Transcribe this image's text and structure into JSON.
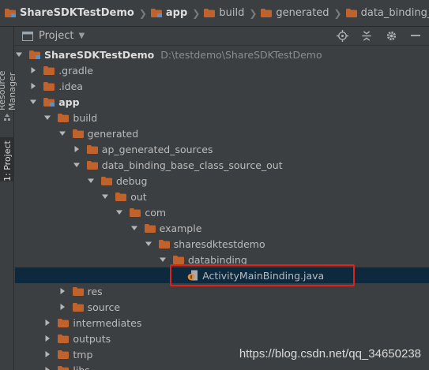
{
  "breadcrumb": [
    {
      "label": "ShareSDKTestDemo",
      "bold": true,
      "icon": "module-folder-icon"
    },
    {
      "label": "app",
      "bold": true,
      "icon": "module-folder-icon"
    },
    {
      "label": "build",
      "bold": false,
      "icon": "folder-icon"
    },
    {
      "label": "generated",
      "bold": false,
      "icon": "folder-icon"
    },
    {
      "label": "data_binding_base_class_s",
      "bold": false,
      "icon": "folder-icon"
    }
  ],
  "sidebar": {
    "tabs": [
      {
        "label": "Resource Manager",
        "active": false
      },
      {
        "label": "1: Project",
        "active": true
      }
    ]
  },
  "panel": {
    "title": "Project",
    "icons": [
      "locate-target-icon",
      "collapse-all-icon",
      "settings-gear-icon",
      "hide-minus-icon"
    ]
  },
  "tree": [
    {
      "depth": 0,
      "arrow": "down",
      "icon": "module",
      "label": "ShareSDKTestDemo",
      "bold": true,
      "path": "D:\\testdemo\\ShareSDKTestDemo"
    },
    {
      "depth": 1,
      "arrow": "right",
      "icon": "folder",
      "label": ".gradle"
    },
    {
      "depth": 1,
      "arrow": "right",
      "icon": "folder",
      "label": ".idea"
    },
    {
      "depth": 1,
      "arrow": "down",
      "icon": "module",
      "label": "app",
      "bold": true
    },
    {
      "depth": 2,
      "arrow": "down",
      "icon": "folder",
      "label": "build"
    },
    {
      "depth": 3,
      "arrow": "down",
      "icon": "folder",
      "label": "generated"
    },
    {
      "depth": 4,
      "arrow": "right",
      "icon": "folder",
      "label": "ap_generated_sources"
    },
    {
      "depth": 4,
      "arrow": "down",
      "icon": "folder",
      "label": "data_binding_base_class_source_out"
    },
    {
      "depth": 5,
      "arrow": "down",
      "icon": "folder",
      "label": "debug"
    },
    {
      "depth": 6,
      "arrow": "down",
      "icon": "folder",
      "label": "out"
    },
    {
      "depth": 7,
      "arrow": "down",
      "icon": "folder",
      "label": "com"
    },
    {
      "depth": 8,
      "arrow": "down",
      "icon": "folder",
      "label": "example"
    },
    {
      "depth": 9,
      "arrow": "down",
      "icon": "folder",
      "label": "sharesdktestdemo"
    },
    {
      "depth": 10,
      "arrow": "down",
      "icon": "folder",
      "label": "databinding"
    },
    {
      "depth": 11,
      "arrow": "none",
      "icon": "java",
      "label": "ActivityMainBinding.java",
      "selected": true
    },
    {
      "depth": 3,
      "arrow": "right",
      "icon": "folder",
      "label": "res"
    },
    {
      "depth": 3,
      "arrow": "right",
      "icon": "folder",
      "label": "source"
    },
    {
      "depth": 2,
      "arrow": "right",
      "icon": "folder",
      "label": "intermediates"
    },
    {
      "depth": 2,
      "arrow": "right",
      "icon": "folder",
      "label": "outputs"
    },
    {
      "depth": 2,
      "arrow": "right",
      "icon": "folder",
      "label": "tmp"
    },
    {
      "depth": 2,
      "arrow": "right",
      "icon": "folder",
      "label": "libs"
    }
  ],
  "watermark": "https://blog.csdn.net/qq_34650238",
  "colors": {
    "folder": "#c0622b",
    "selection": "#0d293e",
    "highlight": "#e0221b"
  }
}
